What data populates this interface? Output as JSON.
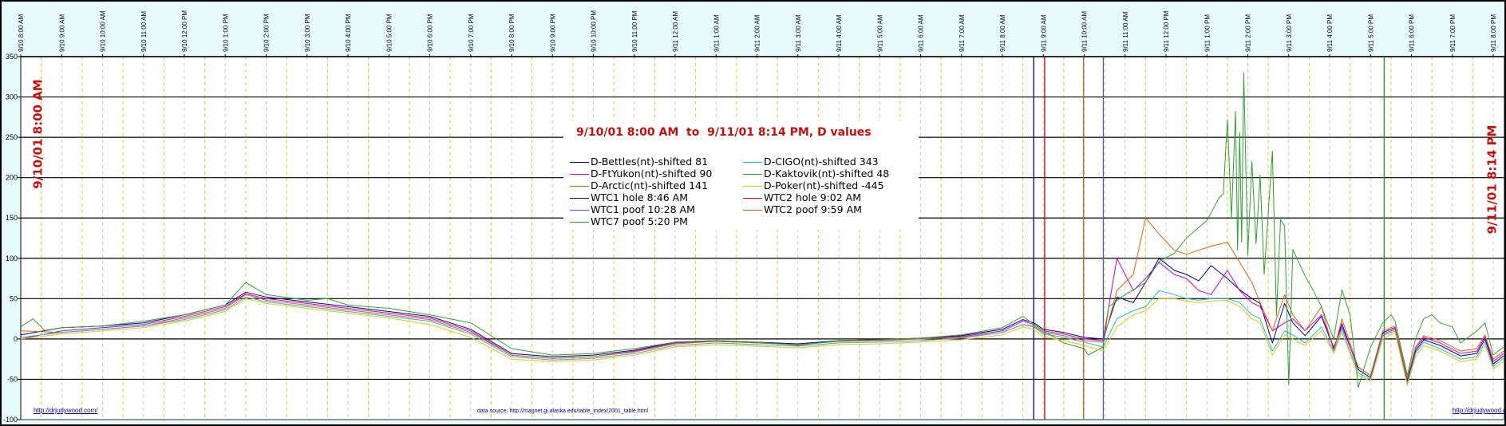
{
  "chart_data": {
    "type": "line",
    "title": "9/10/01 8:00 AM  to  9/11/01 8:14 PM, D values",
    "x_unit": "hours after 9/10 8:00 AM",
    "xlim": [
      0,
      36.25
    ],
    "ylim": [
      -100,
      350
    ],
    "yticks": [
      350,
      300,
      250,
      200,
      150,
      100,
      50,
      0,
      -50,
      -100
    ],
    "xtick_labels": [
      "9/10 8:00 AM",
      "9/10 9:00 AM",
      "9/10 10:00 AM",
      "9/10 11:00 AM",
      "9/10 12:00 PM",
      "9/10 1:00 PM",
      "9/10 2:00 PM",
      "9/10 3:00 PM",
      "9/10 4:00 PM",
      "9/10 5:00 PM",
      "9/10 6:00 PM",
      "9/10 7:00 PM",
      "9/10 8:00 PM",
      "9/10 9:00 PM",
      "9/10 10:00 PM",
      "9/10 11:00 PM",
      "9/11 12:00 AM",
      "9/11 1:00 AM",
      "9/11 2:00 AM",
      "9/11 3:00 AM",
      "9/11 4:00 AM",
      "9/11 5:00 AM",
      "9/11 6:00 AM",
      "9/11 7:00 AM",
      "9/11 8:00 AM",
      "9/11 9:00 AM",
      "9/11 10:00 AM",
      "9/11 11:00 AM",
      "9/11 12:00 PM",
      "9/11 1:00 PM",
      "9/11 2:00 PM",
      "9/11 3:00 PM",
      "9/11 4:00 PM",
      "9/11 5:00 PM",
      "9/11 6:00 PM",
      "9/11 7:00 PM",
      "9/11 8:00 PM"
    ],
    "grid": true,
    "legend_placement": "top-center",
    "hours": [
      0,
      1,
      2,
      3,
      4,
      5,
      5.5,
      6,
      7,
      8,
      9,
      10,
      11,
      12,
      13,
      14,
      15,
      16,
      17,
      18,
      19,
      20,
      21,
      22,
      23,
      24,
      24.5,
      24.77,
      25,
      25.5,
      26,
      26.46,
      26.8,
      27.2,
      27.5,
      27.83,
      28.2,
      28.5,
      28.8,
      29.1,
      29.5,
      29.8,
      30.1,
      30.3,
      30.6,
      30.9,
      31.1,
      31.4,
      31.8,
      32.1,
      32.3,
      32.7,
      33,
      33.3,
      33.6,
      33.9,
      34.1,
      34.3,
      34.7,
      35.2,
      35.6,
      35.8,
      36,
      36.25
    ],
    "series": [
      {
        "name": "D-Bettles(nt)-shifted 81",
        "color": "#000080",
        "values": [
          5,
          14,
          16,
          20,
          30,
          42,
          58,
          52,
          46,
          40,
          34,
          28,
          12,
          -18,
          -22,
          -20,
          -14,
          -4,
          -2,
          -4,
          -6,
          -2,
          -1,
          1,
          4,
          12,
          24,
          20,
          12,
          8,
          2,
          0,
          52,
          45,
          70,
          100,
          85,
          80,
          72,
          91,
          75,
          61,
          50,
          44,
          -5,
          44,
          20,
          4,
          28,
          -12,
          19,
          -38,
          -48,
          8,
          14,
          -52,
          -15,
          -1,
          -8,
          -21,
          -18,
          0,
          -31,
          -21
        ]
      },
      {
        "name": "D-FtYukon(nt)-shifted 90",
        "color": "#cc00cc",
        "values": [
          0,
          10,
          14,
          18,
          28,
          40,
          56,
          50,
          44,
          38,
          32,
          26,
          10,
          -20,
          -24,
          -22,
          -15,
          -5,
          -3,
          -5,
          -7,
          -3,
          -2,
          0,
          3,
          10,
          22,
          18,
          10,
          6,
          0,
          -2,
          100,
          60,
          75,
          95,
          80,
          75,
          60,
          55,
          85,
          60,
          45,
          40,
          10,
          20,
          25,
          10,
          30,
          -10,
          15,
          -35,
          -45,
          6,
          12,
          -50,
          -12,
          2,
          -5,
          -18,
          -15,
          3,
          -28,
          -18
        ]
      },
      {
        "name": "D-Arctic(nt)-shifted 141",
        "color": "#e06010",
        "values": [
          10,
          8,
          12,
          16,
          26,
          38,
          55,
          48,
          42,
          36,
          30,
          24,
          8,
          -20,
          -24,
          -22,
          -16,
          -6,
          -3,
          -5,
          -7,
          -3,
          -2,
          0,
          2,
          8,
          18,
          16,
          8,
          4,
          -2,
          -4,
          60,
          80,
          150,
          130,
          110,
          105,
          110,
          115,
          120,
          95,
          70,
          45,
          10,
          55,
          30,
          10,
          40,
          -15,
          25,
          -35,
          -45,
          10,
          16,
          -48,
          -10,
          4,
          -2,
          -15,
          -12,
          5,
          -25,
          -15
        ]
      },
      {
        "name": "D-CIGO(nt)-shifted 343",
        "color": "#20b8e0",
        "values": [
          2,
          8,
          12,
          16,
          24,
          36,
          52,
          46,
          40,
          34,
          28,
          22,
          6,
          -22,
          -26,
          -24,
          -18,
          -8,
          -5,
          -7,
          -9,
          -5,
          -4,
          -2,
          1,
          8,
          18,
          15,
          6,
          2,
          -4,
          -10,
          25,
          35,
          40,
          60,
          55,
          50,
          48,
          50,
          50,
          45,
          30,
          25,
          -15,
          10,
          5,
          -5,
          15,
          -15,
          12,
          -42,
          -50,
          4,
          10,
          -55,
          -18,
          -4,
          -12,
          -25,
          -22,
          -4,
          -34,
          -24
        ]
      },
      {
        "name": "D-Kaktovik(nt)-shifted 48",
        "color": "#30a030",
        "points": [
          [
            0,
            15
          ],
          [
            0.3,
            25
          ],
          [
            0.6,
            10
          ],
          [
            1,
            14
          ],
          [
            2,
            16
          ],
          [
            3,
            22
          ],
          [
            4,
            30
          ],
          [
            5,
            42
          ],
          [
            5.5,
            70
          ],
          [
            6,
            55
          ],
          [
            7,
            48
          ],
          [
            7.5,
            50
          ],
          [
            8,
            42
          ],
          [
            9,
            38
          ],
          [
            10,
            30
          ],
          [
            11,
            20
          ],
          [
            12,
            -12
          ],
          [
            13,
            -20
          ],
          [
            14,
            -18
          ],
          [
            15,
            -12
          ],
          [
            16,
            -4
          ],
          [
            17,
            -2
          ],
          [
            18,
            -4
          ],
          [
            19,
            -8
          ],
          [
            20,
            -2
          ],
          [
            21,
            -1
          ],
          [
            22,
            1
          ],
          [
            23,
            5
          ],
          [
            24,
            14
          ],
          [
            24.5,
            28
          ],
          [
            25,
            10
          ],
          [
            25.5,
            -5
          ],
          [
            26,
            -12
          ],
          [
            26.1,
            -20
          ],
          [
            26.46,
            -10
          ],
          [
            26.6,
            40
          ],
          [
            27,
            55
          ],
          [
            27.5,
            70
          ],
          [
            27.83,
            96
          ],
          [
            28.2,
            106
          ],
          [
            28.5,
            125
          ],
          [
            29,
            147
          ],
          [
            29.3,
            175
          ],
          [
            29.4,
            180
          ],
          [
            29.5,
            272
          ],
          [
            29.6,
            150
          ],
          [
            29.7,
            282
          ],
          [
            29.75,
            110
          ],
          [
            29.8,
            256
          ],
          [
            29.85,
            120
          ],
          [
            29.9,
            330
          ],
          [
            30,
            104
          ],
          [
            30.1,
            220
          ],
          [
            30.2,
            118
          ],
          [
            30.3,
            203
          ],
          [
            30.4,
            80
          ],
          [
            30.6,
            233
          ],
          [
            30.7,
            29
          ],
          [
            30.8,
            148
          ],
          [
            30.9,
            140
          ],
          [
            31,
            -57
          ],
          [
            31.1,
            111
          ],
          [
            31.2,
            100
          ],
          [
            31.4,
            78
          ],
          [
            31.6,
            60
          ],
          [
            31.8,
            40
          ],
          [
            32.1,
            0
          ],
          [
            32.3,
            61
          ],
          [
            32.5,
            30
          ],
          [
            32.7,
            -60
          ],
          [
            33,
            -10
          ],
          [
            33.3,
            20
          ],
          [
            33.5,
            30
          ],
          [
            33.6,
            22
          ],
          [
            33.9,
            -45
          ],
          [
            34.1,
            0
          ],
          [
            34.3,
            25
          ],
          [
            34.5,
            30
          ],
          [
            34.7,
            20
          ],
          [
            35,
            15
          ],
          [
            35.2,
            -5
          ],
          [
            35.6,
            10
          ],
          [
            35.8,
            20
          ],
          [
            36,
            -20
          ],
          [
            36.25,
            -10
          ]
        ]
      },
      {
        "name": "D-Poker(nt)-shifted -445",
        "color": "#f0c010",
        "values": [
          0,
          6,
          10,
          14,
          22,
          34,
          50,
          44,
          38,
          32,
          26,
          18,
          2,
          -25,
          -28,
          -26,
          -20,
          -10,
          -7,
          -9,
          -11,
          -7,
          -6,
          -4,
          -1,
          5,
          15,
          12,
          3,
          -2,
          -8,
          -15,
          15,
          30,
          35,
          50,
          50,
          47,
          45,
          47,
          48,
          40,
          25,
          20,
          -20,
          5,
          0,
          -8,
          10,
          -18,
          8,
          -45,
          -52,
          0,
          8,
          -58,
          -22,
          -8,
          -15,
          -28,
          -25,
          -8,
          -37,
          -28
        ]
      }
    ],
    "events": [
      {
        "name": "WTC1 hole 8:46 AM",
        "hour": 24.767,
        "color": "#000080"
      },
      {
        "name": "WTC2 hole 9:02 AM",
        "hour": 25.033,
        "color": "#cc0000"
      },
      {
        "name": "WTC2 poof 9:59 AM",
        "hour": 25.983,
        "color": "#d06020"
      },
      {
        "name": "WTC1 poof 10:28 AM",
        "hour": 26.467,
        "color": "#4060c8"
      },
      {
        "name": "WTC7 poof 5:20 PM",
        "hour": 33.333,
        "color": "#20a020"
      }
    ],
    "legend_left": [
      "D-Bettles(nt)-shifted 81",
      "D-FtYukon(nt)-shifted 90",
      "D-Arctic(nt)-shifted 141",
      "WTC1 hole 8:46 AM",
      "WTC1 poof 10:28 AM",
      "WTC7 poof 5:20 PM"
    ],
    "legend_right": [
      "D-CIGO(nt)-shifted 343",
      "D-Kaktovik(nt)-shifted 48",
      "D-Poker(nt)-shifted -445",
      "WTC2 hole 9:02 AM",
      "WTC2 poof 9:59 AM"
    ]
  },
  "legend": {
    "title": "9/10/01 8:00 AM  to  9/11/01 8:14 PM, D values",
    "left": [
      {
        "label": "D-Bettles(nt)-shifted 81",
        "color": "#000080"
      },
      {
        "label": "D-FtYukon(nt)-shifted 90",
        "color": "#cc00cc"
      },
      {
        "label": "D-Arctic(nt)-shifted 141",
        "color": "#e06010"
      },
      {
        "label": "WTC1 hole 8:46 AM",
        "color": "#000080"
      },
      {
        "label": "WTC1 poof 10:28 AM",
        "color": "#4060c8"
      },
      {
        "label": "WTC7 poof 5:20 PM",
        "color": "#20a020"
      }
    ],
    "right": [
      {
        "label": "D-CIGO(nt)-shifted 343",
        "color": "#20b8e0"
      },
      {
        "label": "D-Kaktovik(nt)-shifted 48",
        "color": "#30a030"
      },
      {
        "label": "D-Poker(nt)-shifted -445",
        "color": "#f0c010"
      },
      {
        "label": "WTC2 hole 9:02 AM",
        "color": "#cc0000"
      },
      {
        "label": "WTC2 poof 9:59 AM",
        "color": "#d06020"
      }
    ]
  },
  "annotations": {
    "start_label": "9/10/01 8:00 AM",
    "end_label": "9/11/01 8:14 PM",
    "link_left": "http://drjudywood.com/",
    "link_right": "http://drjudywood.com/",
    "data_source": "data source: http://magnet.gi.alaska.edu/table_index/2001_table.html"
  }
}
